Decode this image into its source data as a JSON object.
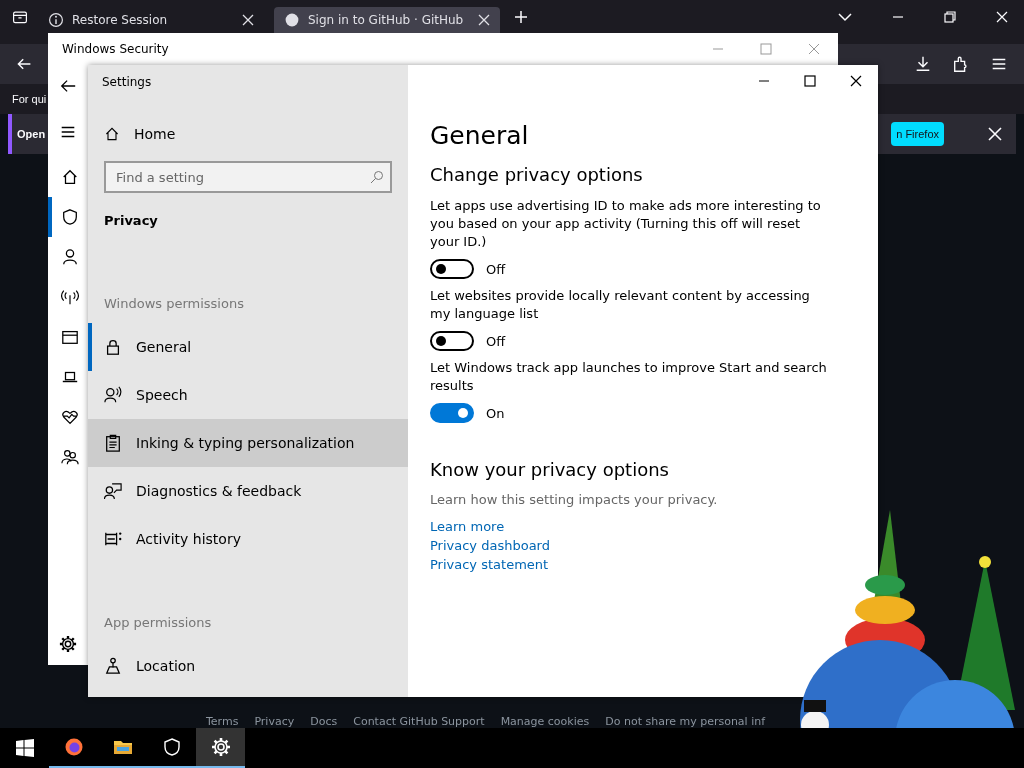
{
  "browser": {
    "tabs": [
      {
        "title": "Restore Session",
        "kind": "info",
        "selected": false
      },
      {
        "title": "Sign in to GitHub · GitHub",
        "kind": "github",
        "selected": true
      }
    ],
    "toolbar_text": "For qui",
    "notification": {
      "text": "Open",
      "button": "n Firefox"
    },
    "footer_links": [
      "Terms",
      "Privacy",
      "Docs",
      "Contact GitHub Support",
      "Manage cookies",
      "Do not share my personal inf"
    ]
  },
  "security_window": {
    "title": "Windows Security",
    "nav": [
      {
        "kind": "home",
        "selected": false
      },
      {
        "kind": "shield",
        "selected": true
      },
      {
        "kind": "person",
        "selected": false
      },
      {
        "kind": "antenna",
        "selected": false
      },
      {
        "kind": "window",
        "selected": false
      },
      {
        "kind": "laptop",
        "selected": false
      },
      {
        "kind": "heart",
        "selected": false
      },
      {
        "kind": "family",
        "selected": false
      }
    ]
  },
  "settings": {
    "title": "Settings",
    "home": "Home",
    "search": {
      "placeholder": "Find a setting"
    },
    "section": "Privacy",
    "groups": [
      {
        "heading": "Windows permissions",
        "items": [
          {
            "label": "General",
            "kind": "lock",
            "selected": true,
            "hovered": false
          },
          {
            "label": "Speech",
            "kind": "speech",
            "selected": false,
            "hovered": false
          },
          {
            "label": "Inking & typing personalization",
            "kind": "clipboard",
            "selected": false,
            "hovered": true
          },
          {
            "label": "Diagnostics & feedback",
            "kind": "feedback",
            "selected": false,
            "hovered": false
          },
          {
            "label": "Activity history",
            "kind": "activity",
            "selected": false,
            "hovered": false
          }
        ]
      },
      {
        "heading": "App permissions",
        "items": [
          {
            "label": "Location",
            "kind": "location",
            "selected": false,
            "hovered": false
          }
        ]
      }
    ],
    "page_title": "General",
    "subtitle": "Change privacy options",
    "options": [
      {
        "description": "Let apps use advertising ID to make ads more interesting to you based on your app activity (Turning this off will reset your ID.)",
        "on": false,
        "state": "Off"
      },
      {
        "description": "Let websites provide locally relevant content by accessing my language list",
        "on": false,
        "state": "Off"
      },
      {
        "description": "Let Windows track app launches to improve Start and search results",
        "on": true,
        "state": "On"
      }
    ],
    "know_title": "Know your privacy options",
    "know_text": "Learn how this setting impacts your privacy.",
    "links": [
      "Learn more",
      "Privacy dashboard",
      "Privacy statement"
    ]
  },
  "taskbar": [
    {
      "kind": "start",
      "selected": false,
      "running": false
    },
    {
      "kind": "firefox",
      "selected": false,
      "running": true
    },
    {
      "kind": "folder",
      "selected": false,
      "running": true
    },
    {
      "kind": "shield",
      "selected": false,
      "running": true
    },
    {
      "kind": "gear",
      "selected": true,
      "running": true
    }
  ]
}
